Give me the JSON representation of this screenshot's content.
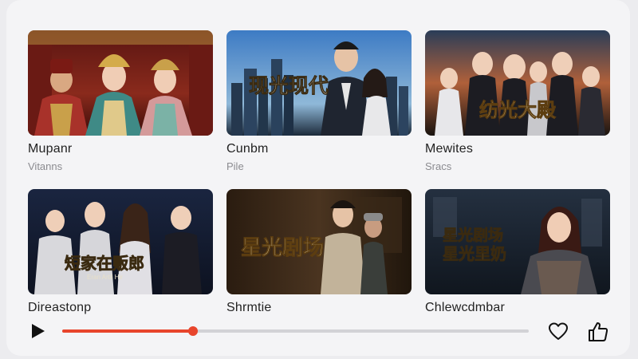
{
  "grid": {
    "items": [
      {
        "title": "Mupanr",
        "subtitle": "Vitanns",
        "overlay": "",
        "overlay_sub": ""
      },
      {
        "title": "Cunbm",
        "subtitle": "Pile",
        "overlay": "现光现代",
        "overlay_sub": ""
      },
      {
        "title": "Mewites",
        "subtitle": "Sracs",
        "overlay": "纺光大殿",
        "overlay_sub": ""
      },
      {
        "title": "Direastonp",
        "subtitle": "",
        "overlay": "短家在贩郎",
        "overlay_sub": "Eran Artil Hir"
      },
      {
        "title": "Shrmtie",
        "subtitle": "",
        "overlay": "星光剧场",
        "overlay_sub": ""
      },
      {
        "title": "Chlewcdmbar",
        "subtitle": "",
        "overlay": "星光剧场",
        "overlay_sub": "星光里奶"
      }
    ]
  },
  "player": {
    "progress": 0.28,
    "accent_color": "#e8452c",
    "icons": {
      "play": "play-icon",
      "favorite": "heart-icon",
      "like": "thumbs-up-icon"
    }
  }
}
